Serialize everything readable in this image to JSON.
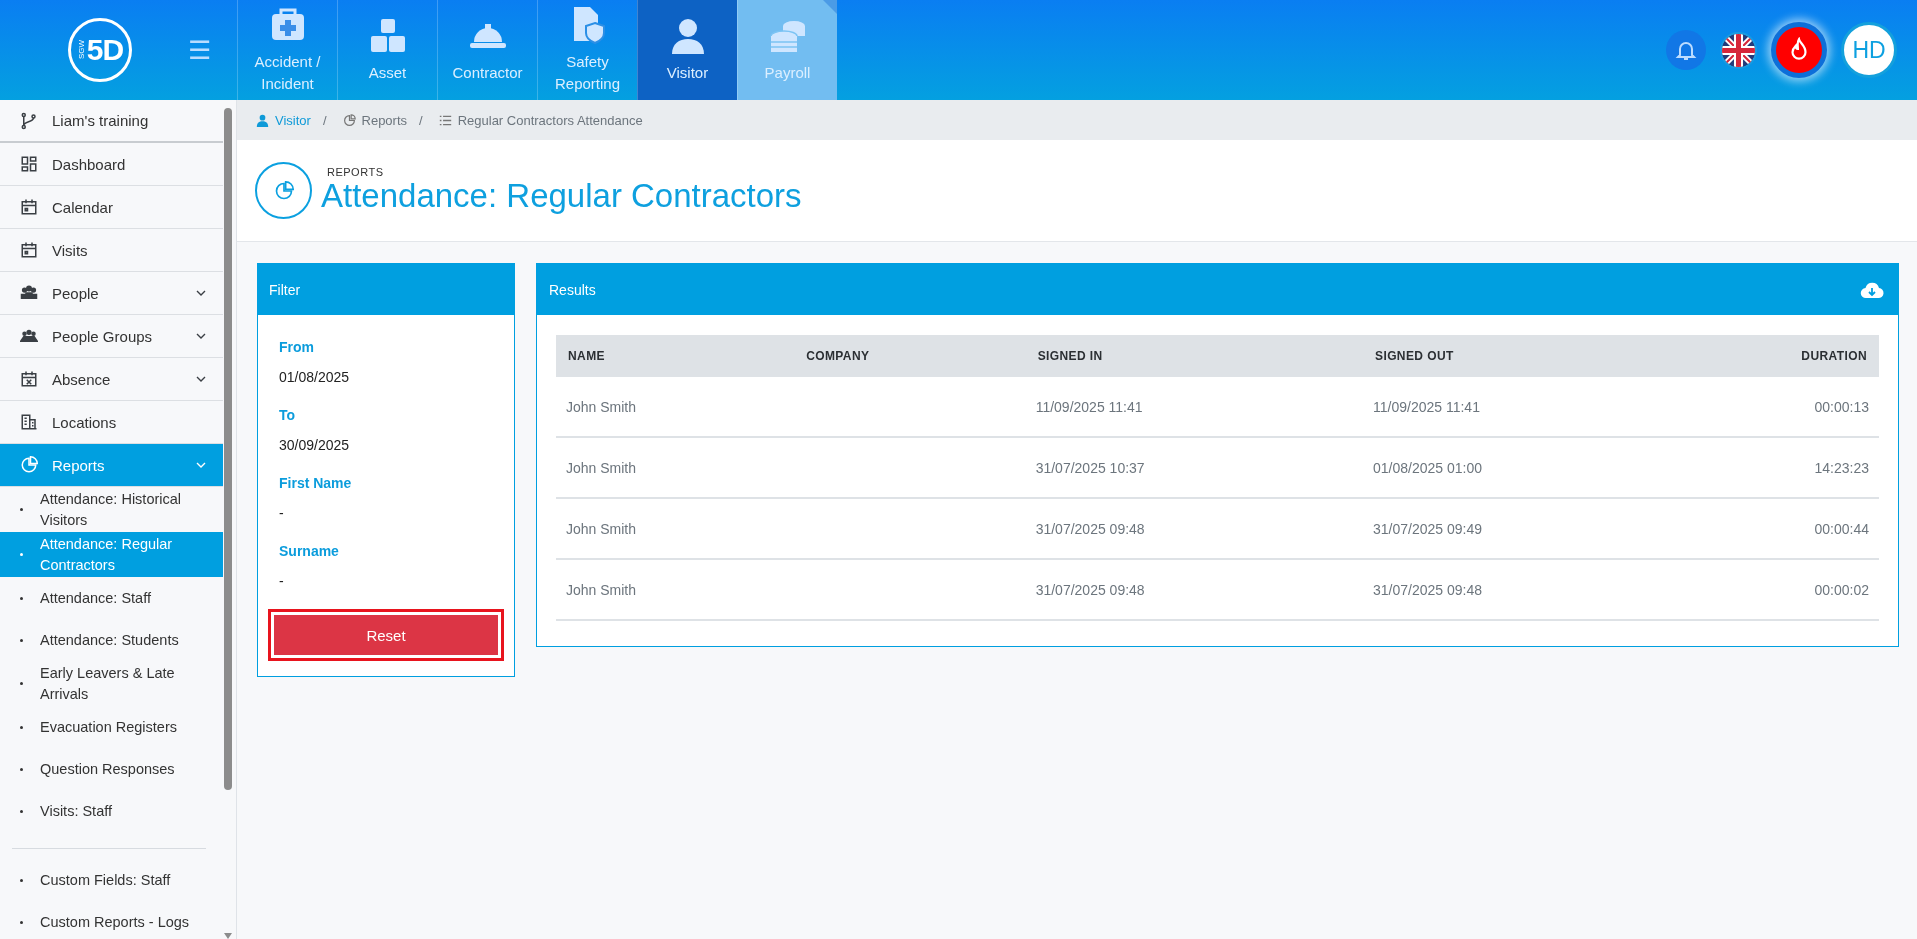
{
  "logo": {
    "mark": "5D",
    "small": "SGW"
  },
  "menu_toggle": "☰",
  "modules": [
    {
      "label": "Accident / Incident",
      "selected": false,
      "hovered": false
    },
    {
      "label": "Asset",
      "selected": false,
      "hovered": false
    },
    {
      "label": "Contractor",
      "selected": false,
      "hovered": false
    },
    {
      "label": "Safety Reporting",
      "selected": false,
      "hovered": false
    },
    {
      "label": "Visitor",
      "selected": true,
      "hovered": false
    },
    {
      "label": "Payroll",
      "selected": false,
      "hovered": true
    }
  ],
  "user": {
    "initials": "HD"
  },
  "sidebar": {
    "items": [
      {
        "label": "Liam's training",
        "selected": false,
        "submenu": false
      },
      {
        "label": "Dashboard",
        "selected": false,
        "submenu": false
      },
      {
        "label": "Calendar",
        "selected": false,
        "submenu": false
      },
      {
        "label": "Visits",
        "selected": false,
        "submenu": false
      },
      {
        "label": "People",
        "selected": false,
        "submenu": true
      },
      {
        "label": "People Groups",
        "selected": false,
        "submenu": true
      },
      {
        "label": "Absence",
        "selected": false,
        "submenu": true
      },
      {
        "label": "Locations",
        "selected": false,
        "submenu": false
      },
      {
        "label": "Reports",
        "selected": true,
        "submenu": true,
        "children": [
          {
            "kind": "link",
            "label": "Attendance: Historical Visitors",
            "selected": false
          },
          {
            "kind": "link",
            "label": "Attendance: Regular Contractors",
            "selected": true
          },
          {
            "kind": "link",
            "label": "Attendance: Staff",
            "selected": false
          },
          {
            "kind": "link",
            "label": "Attendance: Students",
            "selected": false
          },
          {
            "kind": "link",
            "label": "Early Leavers & Late Arrivals",
            "selected": false
          },
          {
            "kind": "link",
            "label": "Evacuation Registers",
            "selected": false
          },
          {
            "kind": "link",
            "label": "Question Responses",
            "selected": false
          },
          {
            "kind": "link",
            "label": "Visits: Staff",
            "selected": false
          },
          {
            "kind": "divider"
          },
          {
            "kind": "link",
            "label": "Custom Fields: Staff",
            "selected": false
          },
          {
            "kind": "link",
            "label": "Custom Reports - Logs",
            "selected": false
          }
        ]
      }
    ]
  },
  "breadcrumb": [
    {
      "label": "Visitor",
      "separator": "/"
    },
    {
      "label": "Reports",
      "separator": "/"
    },
    {
      "label": "Regular Contractors Attendance"
    }
  ],
  "header": {
    "eyebrow": "REPORTS",
    "title": "Attendance: Regular Contractors"
  },
  "filter": {
    "title": "Filter",
    "fields": [
      {
        "label": "From",
        "value": "01/08/2025"
      },
      {
        "label": "To",
        "value": "30/09/2025"
      },
      {
        "label": "First Name",
        "value": "-"
      },
      {
        "label": "Surname",
        "value": "-"
      }
    ],
    "reset_button": {
      "label": "Reset",
      "focused": true
    }
  },
  "results": {
    "title": "Results",
    "table": {
      "columns": [
        {
          "label": "NAME"
        },
        {
          "label": "COMPANY"
        },
        {
          "label": "SIGNED IN"
        },
        {
          "label": "SIGNED OUT"
        },
        {
          "label": "DURATION"
        }
      ],
      "rows": [
        [
          "John Smith",
          "",
          "11/09/2025 11:41",
          "11/09/2025 11:41",
          "00:00:13"
        ],
        [
          "John Smith",
          "",
          "31/07/2025 10:37",
          "01/08/2025 01:00",
          "14:23:23"
        ],
        [
          "John Smith",
          "",
          "31/07/2025 09:48",
          "31/07/2025 09:49",
          "00:00:44"
        ],
        [
          "John Smith",
          "",
          "31/07/2025 09:48",
          "31/07/2025 09:48",
          "00:00:02"
        ]
      ]
    }
  }
}
